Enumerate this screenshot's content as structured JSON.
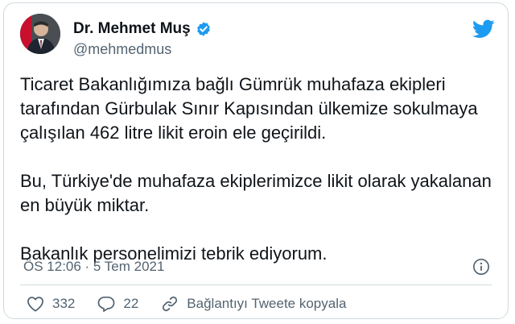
{
  "tweet": {
    "author_name": "Dr. Mehmet Muş",
    "handle": "@mehmedmus",
    "paragraphs": [
      "Ticaret Bakanlığımıza bağlı Gümrük muhafaza ekipleri tarafından Gürbulak Sınır Kapısından ülkemize sokulmaya çalışılan 462 litre likit eroin ele geçirildi.",
      "Bu, Türkiye'de muhafaza ekiplerimizce likit olarak yakalanan en büyük miktar.",
      "Bakanlık personelimizi tebrik ediyorum."
    ],
    "timestamp": "ÖS 12:06 · 5 Tem 2021",
    "likes": "332",
    "replies": "22",
    "copy_link_label": "Bağlantıyı Tweete kopyala"
  },
  "icons": {
    "verified": "verified-badge-icon",
    "brand": "twitter-bird-icon",
    "info": "info-icon",
    "like": "heart-icon",
    "reply": "reply-bubble-icon",
    "link": "link-icon"
  },
  "colors": {
    "brand_blue": "#1d9bf0",
    "text_primary": "#0f1419",
    "text_secondary": "#536471",
    "border": "#cfd9de"
  }
}
